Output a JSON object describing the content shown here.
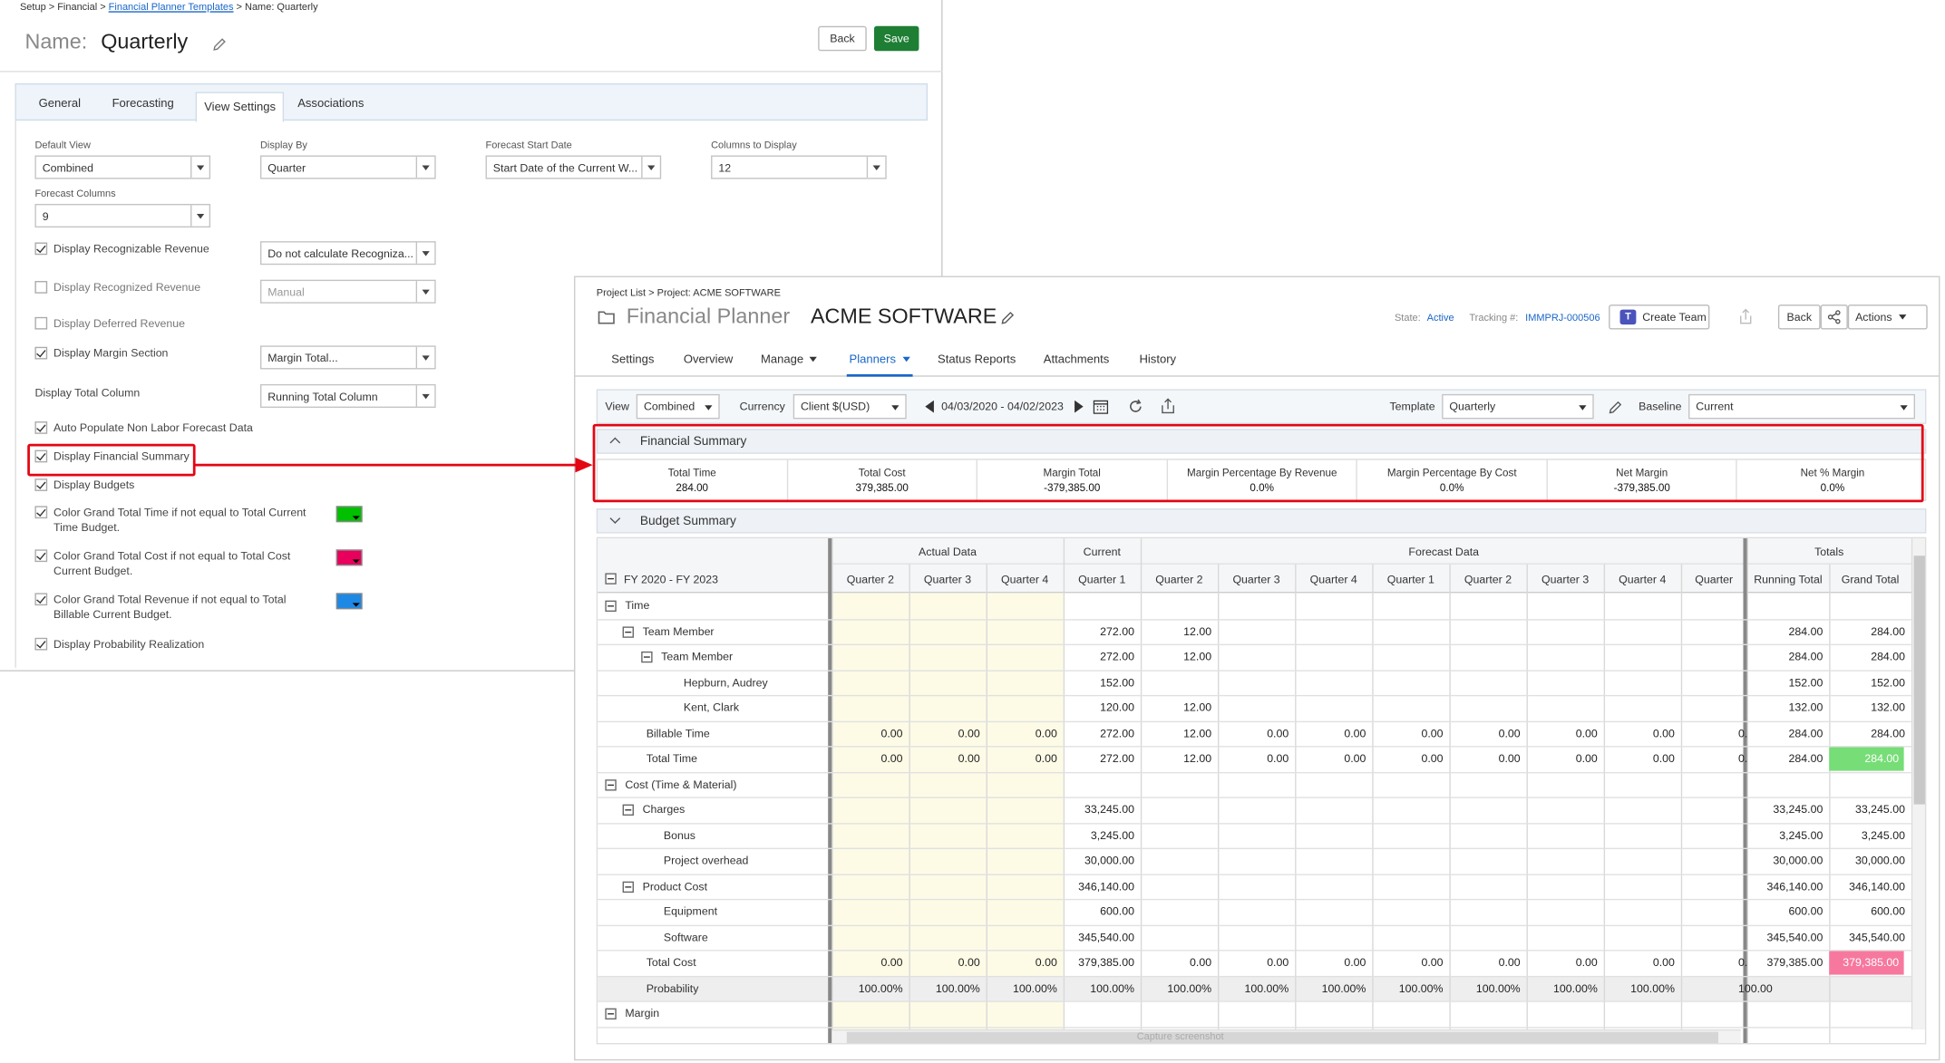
{
  "setup": {
    "breadcrumb": {
      "part1": "Setup > Financial > ",
      "link": "Financial Planner Templates",
      "part2": " > Name: Quarterly"
    },
    "title_label": "Name:",
    "title_value": "Quarterly",
    "back_label": "Back",
    "save_label": "Save",
    "tabs": [
      "General",
      "Forecasting",
      "View Settings",
      "Associations"
    ],
    "fields": {
      "default_view": {
        "label": "Default View",
        "value": "Combined"
      },
      "display_by": {
        "label": "Display By",
        "value": "Quarter"
      },
      "forecast_start": {
        "label": "Forecast Start Date",
        "value": "Start Date of the Current W..."
      },
      "columns_display": {
        "label": "Columns to Display",
        "value": "12"
      },
      "forecast_columns": {
        "label": "Forecast Columns",
        "value": "9"
      }
    },
    "checks": [
      {
        "label": "Display Recognizable Revenue",
        "checked": true
      },
      {
        "label": "Display Recognized Revenue",
        "checked": false
      },
      {
        "label": "Display Deferred Revenue",
        "checked": false
      },
      {
        "label": "Display Margin Section",
        "checked": true
      },
      {
        "label": "Auto Populate Non Labor Forecast Data",
        "checked": true
      },
      {
        "label": "Display Financial Summary",
        "checked": true
      },
      {
        "label": "Display Budgets",
        "checked": true
      },
      {
        "label": "Color Grand Total Time if not equal to Total Current Time Budget.",
        "checked": true
      },
      {
        "label": "Color Grand Total Cost if not equal to Total Cost Current Budget.",
        "checked": true
      },
      {
        "label": "Color Grand Total Revenue if not equal to Total Billable Current Budget.",
        "checked": true
      },
      {
        "label": "Display Probability Realization",
        "checked": true
      }
    ],
    "selects": {
      "recognizable": "Do not calculate Recogniza...",
      "recognized": "Manual",
      "margin": "Margin Total...",
      "total_column": "Running Total Column"
    },
    "display_total_label": "Display Total Column",
    "colors": {
      "time": "#00c000",
      "cost": "#e8005c",
      "revenue": "#1e88e5"
    }
  },
  "planner": {
    "breadcrumb": "Project List > Project: ACME SOFTWARE",
    "title_label": "Financial Planner",
    "title_value": "ACME SOFTWARE",
    "state_label": "State:",
    "state_value": "Active",
    "tracking_label": "Tracking #:",
    "tracking_value": "IMMPRJ-000506",
    "create_team": "Create Team",
    "back": "Back",
    "actions": "Actions",
    "nav": [
      "Settings",
      "Overview",
      "Manage",
      "Planners",
      "Status Reports",
      "Attachments",
      "History"
    ],
    "filter": {
      "view_label": "View",
      "view": "Combined",
      "currency_label": "Currency",
      "currency": "Client $(USD)",
      "range": "04/03/2020 - 04/02/2023",
      "template_label": "Template",
      "template": "Quarterly",
      "baseline_label": "Baseline",
      "baseline": "Current"
    },
    "financial_summary": {
      "title": "Financial Summary",
      "items": [
        {
          "label": "Total Time",
          "value": "284.00"
        },
        {
          "label": "Total Cost",
          "value": "379,385.00"
        },
        {
          "label": "Margin Total",
          "value": "-379,385.00"
        },
        {
          "label": "Margin Percentage By Revenue",
          "value": "0.0%"
        },
        {
          "label": "Margin Percentage By Cost",
          "value": "0.0%"
        },
        {
          "label": "Net Margin",
          "value": "-379,385.00"
        },
        {
          "label": "Net % Margin",
          "value": "0.0%"
        }
      ]
    },
    "budget_summary": {
      "title": "Budget Summary"
    },
    "grid": {
      "period": "FY 2020 - FY 2023",
      "groups": [
        "Actual Data",
        "Current",
        "Forecast Data",
        "Totals"
      ],
      "columns": [
        "Quarter 2",
        "Quarter 3",
        "Quarter 4",
        "Quarter 1",
        "Quarter 2",
        "Quarter 3",
        "Quarter 4",
        "Quarter 1",
        "Quarter 2",
        "Quarter 3",
        "Quarter 4",
        "Quarter",
        "Running Total",
        "Grand Total"
      ],
      "rows": [
        {
          "label": "Time",
          "level": 0,
          "toggle": true,
          "cells": [
            "",
            "",
            "",
            "",
            "",
            "",
            "",
            "",
            "",
            "",
            "",
            "",
            "",
            ""
          ]
        },
        {
          "label": "Team Member",
          "level": 1,
          "toggle": true,
          "cells": [
            "",
            "",
            "",
            "272.00",
            "12.00",
            "",
            "",
            "",
            "",
            "",
            "",
            "",
            "284.00",
            "284.00"
          ]
        },
        {
          "label": "Team Member",
          "level": 2,
          "toggle": true,
          "cells": [
            "",
            "",
            "",
            "272.00",
            "12.00",
            "",
            "",
            "",
            "",
            "",
            "",
            "",
            "284.00",
            "284.00"
          ]
        },
        {
          "label": "Hepburn, Audrey",
          "level": 3,
          "toggle": false,
          "cells": [
            "",
            "",
            "",
            "152.00",
            "",
            "",
            "",
            "",
            "",
            "",
            "",
            "",
            "152.00",
            "152.00"
          ]
        },
        {
          "label": "Kent, Clark",
          "level": 3,
          "toggle": false,
          "cells": [
            "",
            "",
            "",
            "120.00",
            "12.00",
            "",
            "",
            "",
            "",
            "",
            "",
            "",
            "132.00",
            "132.00"
          ]
        },
        {
          "label": "Billable Time",
          "level": 1,
          "toggle": false,
          "cells": [
            "0.00",
            "0.00",
            "0.00",
            "272.00",
            "12.00",
            "0.00",
            "0.00",
            "0.00",
            "0.00",
            "0.00",
            "0.00",
            "0.",
            "284.00",
            "284.00"
          ]
        },
        {
          "label": "Total Time",
          "level": 1,
          "toggle": false,
          "cells": [
            "0.00",
            "0.00",
            "0.00",
            "272.00",
            "12.00",
            "0.00",
            "0.00",
            "0.00",
            "0.00",
            "0.00",
            "0.00",
            "0.",
            "284.00",
            "284.00"
          ],
          "hl": "#77dd77"
        },
        {
          "label": "Cost (Time & Material)",
          "level": 0,
          "toggle": true,
          "cells": [
            "",
            "",
            "",
            "",
            "",
            "",
            "",
            "",
            "",
            "",
            "",
            "",
            "",
            ""
          ]
        },
        {
          "label": "Charges",
          "level": 1,
          "toggle": true,
          "cells": [
            "",
            "",
            "",
            "33,245.00",
            "",
            "",
            "",
            "",
            "",
            "",
            "",
            "",
            "33,245.00",
            "33,245.00"
          ]
        },
        {
          "label": "Bonus",
          "level": 3,
          "toggle": false,
          "cells": [
            "",
            "",
            "",
            "3,245.00",
            "",
            "",
            "",
            "",
            "",
            "",
            "",
            "",
            "3,245.00",
            "3,245.00"
          ]
        },
        {
          "label": "Project overhead",
          "level": 3,
          "toggle": false,
          "cells": [
            "",
            "",
            "",
            "30,000.00",
            "",
            "",
            "",
            "",
            "",
            "",
            "",
            "",
            "30,000.00",
            "30,000.00"
          ]
        },
        {
          "label": "Product Cost",
          "level": 1,
          "toggle": true,
          "cells": [
            "",
            "",
            "",
            "346,140.00",
            "",
            "",
            "",
            "",
            "",
            "",
            "",
            "",
            "346,140.00",
            "346,140.00"
          ]
        },
        {
          "label": "Equipment",
          "level": 3,
          "toggle": false,
          "cells": [
            "",
            "",
            "",
            "600.00",
            "",
            "",
            "",
            "",
            "",
            "",
            "",
            "",
            "600.00",
            "600.00"
          ]
        },
        {
          "label": "Software",
          "level": 3,
          "toggle": false,
          "cells": [
            "",
            "",
            "",
            "345,540.00",
            "",
            "",
            "",
            "",
            "",
            "",
            "",
            "",
            "345,540.00",
            "345,540.00"
          ]
        },
        {
          "label": "Total Cost",
          "level": 1,
          "toggle": false,
          "cells": [
            "0.00",
            "0.00",
            "0.00",
            "379,385.00",
            "0.00",
            "0.00",
            "0.00",
            "0.00",
            "0.00",
            "0.00",
            "0.00",
            "0.",
            "379,385.00",
            "379,385.00"
          ],
          "hl": "#f7789f"
        },
        {
          "label": "Probability",
          "level": 1,
          "toggle": false,
          "cells": [
            "100.00%",
            "100.00%",
            "100.00%",
            "100.00%",
            "100.00%",
            "100.00%",
            "100.00%",
            "100.00%",
            "100.00%",
            "100.00%",
            "100.00%",
            "100.00",
            "",
            ""
          ],
          "shade": true
        },
        {
          "label": "Margin",
          "level": 0,
          "toggle": true,
          "cells": [
            "",
            "",
            "",
            "",
            "",
            "",
            "",
            "",
            "",
            "",
            "",
            "",
            "",
            ""
          ]
        }
      ]
    },
    "scroll_hint": "Capture screenshot"
  }
}
